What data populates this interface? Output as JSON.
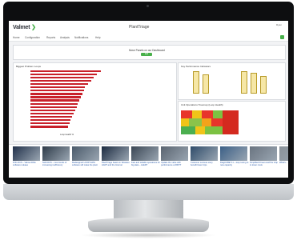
{
  "app": {
    "logo_text": "Valmet",
    "title": "PlantTriage",
    "user": "Ryan"
  },
  "nav": {
    "items": [
      "Home",
      "Configuration",
      "Reports",
      "Analysis",
      "Notifications",
      "Help"
    ]
  },
  "banner": {
    "text": "Move Panels on our Dashboard",
    "button_label": "Edit"
  },
  "panels": {
    "biggest_title": "Biggest Problem Loops",
    "biggest_xlabel": "Loop Health %",
    "kpi_title": "Key Performance Indicators",
    "heatmap_title": "Unit Operations Treemap (Loop Health)"
  },
  "chart_data": {
    "type": "bar",
    "orientation": "horizontal",
    "title": "Biggest Problem Loops",
    "xlabel": "Loop Health %",
    "categories": [
      "",
      "",
      "",
      "",
      "",
      "",
      "",
      "",
      "",
      "",
      "",
      "",
      "",
      "",
      "",
      "",
      "",
      ""
    ],
    "values": [
      98,
      92,
      88,
      84,
      80,
      76,
      74,
      72,
      70,
      68,
      66,
      64,
      62,
      60,
      58,
      56,
      54,
      52
    ],
    "bar_color": "#c8202a"
  },
  "news": {
    "items": [
      {
        "caption": "FNC-DCS – Valmet DNA software release"
      },
      {
        "caption": "NHS DCS – new trends of increasing inefficiency"
      },
      {
        "caption": "Redesigned LOOP DATA software will make the plant"
      },
      {
        "caption": "PlantTriage basics in Wireless HART and the Internet"
      },
      {
        "caption": "Fast and reliable operations for big data – ALERT"
      },
      {
        "caption": "Update the valve with performance at RMTT"
      },
      {
        "caption": "Customer success story benefit fewer trips"
      },
      {
        "caption": "DiagCUBE 5.1 – loop tuning to new capacity"
      },
      {
        "caption": "Simplified threat cutoff for ship to lower costs"
      },
      {
        "caption": "What's..."
      }
    ]
  },
  "colors": {
    "brand_green": "#48b04a",
    "bar_red": "#c8202a"
  }
}
